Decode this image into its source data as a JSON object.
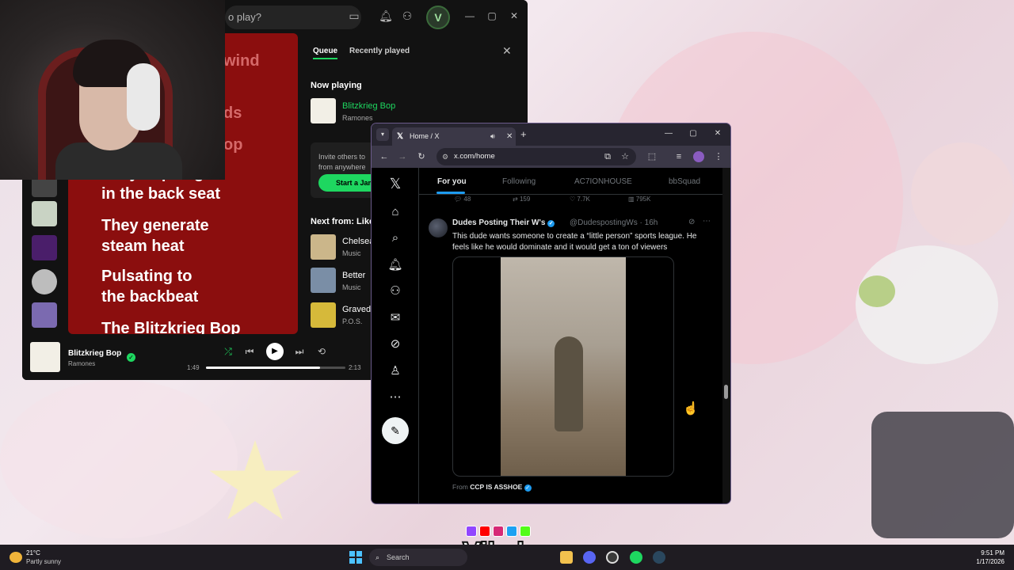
{
  "spotify": {
    "search_placeholder": "o play?",
    "lyrics": [
      "wind",
      "ds",
      "op",
      "They're piling",
      "in the back seat",
      "They generate",
      "steam heat",
      "Pulsating to",
      "the backbeat",
      "The Blitzkrieg Bop"
    ],
    "queue": {
      "tab_queue": "Queue",
      "tab_recent": "Recently played",
      "now_playing_heading": "Now playing",
      "now_title": "Blitzkrieg Bop",
      "now_artist": "Ramones",
      "invite_text_1": "Invite others to",
      "invite_text_2": "from anywhere",
      "invite_button": "Start a Jam",
      "next_heading": "Next from: Like",
      "next_items": [
        {
          "title": "Chelsea",
          "sub": "Music"
        },
        {
          "title": "Better",
          "sub": "Music"
        },
        {
          "title": "Graved",
          "sub": "P.O.S."
        }
      ]
    },
    "player": {
      "title": "Blitzkrieg Bop",
      "artist": "Ramones",
      "elapsed": "1:49",
      "duration": "2:13",
      "progress": 0.82
    },
    "accent": "#1ed760",
    "lyrics_bg": "#8b0e0e"
  },
  "browser": {
    "tab_title": "Home / X",
    "url": "x.com/home"
  },
  "x": {
    "tabs": [
      "For you",
      "Following",
      "AC7IONHOUSE",
      "bbSquad"
    ],
    "metrics": [
      "48",
      "159",
      "7.7K",
      "795K"
    ],
    "post": {
      "name": "Dudes Posting Their W's",
      "handle": "@DudespostingWs · 16h",
      "text": "This dude wants someone to create a “little person” sports league. He feels like he would dominate and it would get a ton of viewers",
      "from_label": "From",
      "from_name": "CCP IS ASSHOE"
    },
    "accent": "#1d9bf0"
  },
  "overlay": {
    "brand": "Vibzlo"
  },
  "taskbar": {
    "temp": "21°C",
    "condition": "Partly sunny",
    "search_label": "Search",
    "time": "9:51 PM",
    "date": "1/17/2026"
  }
}
